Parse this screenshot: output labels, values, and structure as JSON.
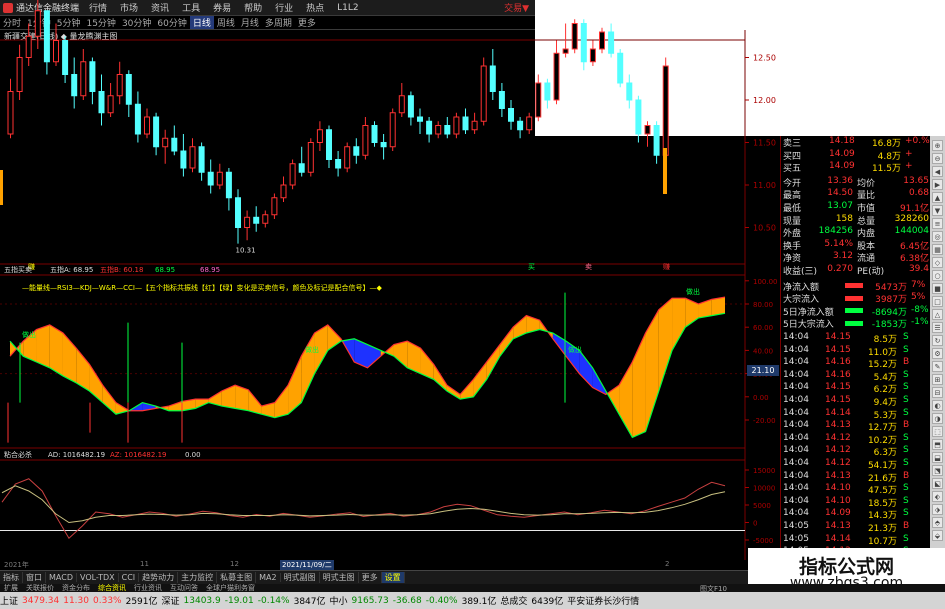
{
  "window": {
    "app_title": "通达信金融终端",
    "brand": "交易▼",
    "menu": [
      "行情",
      "市场",
      "资讯",
      "工具",
      "券易",
      "帮助",
      "行业",
      "热点",
      "L1L2"
    ]
  },
  "periods": {
    "items": [
      "分时",
      "1分钟",
      "5分钟",
      "15分钟",
      "30分钟",
      "60分钟",
      "日线",
      "周线",
      "月线",
      "多周期",
      "更多"
    ],
    "active": 6
  },
  "main_chart": {
    "title": "新疆交建(日线) ◆ 量龙腾渊主图",
    "low_label": "10.31",
    "yticks": [
      "12.50",
      "12.00",
      "11.50",
      "11.00",
      "10.50"
    ],
    "signals": [
      "赚",
      "买",
      "卖",
      "赚"
    ],
    "candles": [
      [
        11.6,
        12.25,
        11.55,
        12.1
      ],
      [
        12.1,
        12.65,
        12.0,
        12.5
      ],
      [
        12.5,
        12.9,
        12.4,
        12.75
      ],
      [
        12.75,
        13.2,
        12.6,
        13.05
      ],
      [
        13.05,
        13.0,
        12.3,
        12.45
      ],
      [
        12.45,
        12.9,
        12.4,
        12.7
      ],
      [
        12.7,
        12.75,
        12.2,
        12.3
      ],
      [
        12.3,
        12.5,
        11.9,
        12.05
      ],
      [
        12.05,
        12.6,
        12.0,
        12.45
      ],
      [
        12.45,
        12.5,
        11.95,
        12.1
      ],
      [
        12.1,
        12.3,
        11.7,
        11.85
      ],
      [
        11.85,
        12.2,
        11.8,
        12.05
      ],
      [
        12.05,
        12.45,
        11.95,
        12.3
      ],
      [
        12.3,
        12.35,
        11.8,
        11.95
      ],
      [
        11.95,
        12.1,
        11.5,
        11.6
      ],
      [
        11.6,
        11.9,
        11.55,
        11.8
      ],
      [
        11.8,
        11.85,
        11.35,
        11.45
      ],
      [
        11.45,
        11.65,
        11.25,
        11.55
      ],
      [
        11.55,
        11.7,
        11.35,
        11.4
      ],
      [
        11.4,
        11.6,
        11.1,
        11.2
      ],
      [
        11.2,
        11.55,
        11.15,
        11.45
      ],
      [
        11.45,
        11.5,
        11.05,
        11.15
      ],
      [
        11.15,
        11.3,
        10.9,
        11.0
      ],
      [
        11.0,
        11.25,
        10.95,
        11.15
      ],
      [
        11.15,
        11.2,
        10.7,
        10.85
      ],
      [
        10.85,
        10.95,
        10.31,
        10.5
      ],
      [
        10.5,
        10.7,
        10.35,
        10.62
      ],
      [
        10.62,
        10.75,
        10.45,
        10.55
      ],
      [
        10.55,
        10.7,
        10.5,
        10.65
      ],
      [
        10.65,
        10.9,
        10.6,
        10.85
      ],
      [
        10.85,
        11.1,
        10.8,
        11.0
      ],
      [
        11.0,
        11.3,
        10.95,
        11.25
      ],
      [
        11.25,
        11.45,
        11.1,
        11.15
      ],
      [
        11.15,
        11.55,
        11.1,
        11.5
      ],
      [
        11.5,
        11.75,
        11.4,
        11.65
      ],
      [
        11.65,
        11.7,
        11.2,
        11.3
      ],
      [
        11.3,
        11.4,
        11.1,
        11.2
      ],
      [
        11.2,
        11.5,
        11.15,
        11.45
      ],
      [
        11.45,
        11.55,
        11.25,
        11.35
      ],
      [
        11.35,
        11.8,
        11.3,
        11.7
      ],
      [
        11.7,
        11.75,
        11.45,
        11.5
      ],
      [
        11.5,
        11.6,
        11.3,
        11.45
      ],
      [
        11.45,
        11.9,
        11.4,
        11.85
      ],
      [
        11.85,
        12.2,
        11.8,
        12.05
      ],
      [
        12.05,
        12.1,
        11.7,
        11.8
      ],
      [
        11.8,
        11.9,
        11.6,
        11.75
      ],
      [
        11.75,
        11.8,
        11.5,
        11.6
      ],
      [
        11.6,
        11.75,
        11.55,
        11.7
      ],
      [
        11.7,
        11.8,
        11.55,
        11.6
      ],
      [
        11.6,
        11.85,
        11.55,
        11.8
      ],
      [
        11.8,
        11.9,
        11.6,
        11.65
      ],
      [
        11.65,
        11.85,
        11.6,
        11.75
      ],
      [
        11.75,
        12.5,
        11.7,
        12.4
      ],
      [
        12.4,
        12.6,
        12.0,
        12.1
      ],
      [
        12.1,
        12.2,
        11.8,
        11.9
      ],
      [
        11.9,
        12.0,
        11.65,
        11.75
      ],
      [
        11.75,
        11.8,
        11.55,
        11.65
      ],
      [
        11.65,
        11.85,
        11.6,
        11.8
      ],
      [
        11.8,
        12.3,
        11.75,
        12.2
      ],
      [
        12.2,
        12.25,
        11.9,
        12.0
      ],
      [
        12.0,
        12.7,
        11.95,
        12.55
      ],
      [
        12.55,
        12.9,
        12.5,
        12.6
      ],
      [
        12.6,
        12.95,
        12.55,
        12.9
      ],
      [
        12.9,
        12.95,
        12.35,
        12.45
      ],
      [
        12.45,
        12.7,
        12.4,
        12.6
      ],
      [
        12.6,
        12.85,
        12.55,
        12.8
      ],
      [
        12.8,
        12.9,
        12.5,
        12.55
      ],
      [
        12.55,
        12.6,
        12.15,
        12.2
      ],
      [
        12.2,
        12.3,
        11.9,
        12.0
      ],
      [
        12.0,
        12.05,
        11.5,
        11.6
      ],
      [
        11.6,
        11.75,
        11.45,
        11.7
      ],
      [
        11.7,
        11.75,
        11.25,
        11.35
      ],
      [
        11.35,
        12.5,
        11.3,
        12.4
      ]
    ]
  },
  "osc": {
    "header": {
      "name": "五指买卖",
      "a": "五指A: 68.95",
      "b": "五指B: 60.18",
      "c": "68.95",
      "d": "68.95"
    },
    "legend": "—能量线—RSI3—KDJ—W&R—CCI—【五个指标共振线【红】【绿】变化是买卖信号，颜色及标记是配合信号】—◆",
    "yticks": [
      "100.00",
      "80.00",
      "60.00",
      "40.00",
      "20.00",
      "0.00",
      "-20.00"
    ],
    "marks": [
      "做出",
      "做出",
      "做出",
      "做出"
    ],
    "upper": [
      35,
      48,
      58,
      62,
      55,
      42,
      28,
      10,
      -5,
      -12,
      -12,
      -10,
      -8,
      -4,
      -2,
      -2,
      5,
      10,
      6,
      -8,
      -5,
      10,
      35,
      55,
      62,
      50,
      30,
      25,
      35,
      45,
      48,
      42,
      28,
      10,
      2,
      15,
      30,
      45,
      60,
      70,
      66,
      50,
      35,
      20,
      8,
      2,
      10,
      30,
      55,
      75,
      85,
      85,
      80,
      84,
      86
    ],
    "lower": [
      48,
      35,
      30,
      25,
      18,
      12,
      5,
      -5,
      -15,
      -12,
      -5,
      -8,
      -12,
      -12,
      -10,
      -5,
      -8,
      -10,
      -12,
      -15,
      -18,
      -15,
      -5,
      20,
      40,
      48,
      50,
      45,
      40,
      35,
      25,
      20,
      15,
      5,
      -2,
      0,
      15,
      35,
      50,
      55,
      58,
      55,
      48,
      40,
      25,
      5,
      -15,
      -35,
      -30,
      5,
      40,
      60,
      68,
      70,
      72
    ]
  },
  "ad": {
    "header": {
      "name": "粘合必杀",
      "ad": "AD: 1016482.19",
      "az": "AZ: 1016482.19",
      "v": "0.00"
    },
    "yticks": [
      "15000",
      "10000",
      "5000",
      "0",
      "-5000"
    ],
    "line1": [
      5800,
      11000,
      12500,
      9000,
      2000,
      -4500,
      -1000,
      3000,
      2500,
      1500,
      2200,
      3000,
      2600,
      1800,
      2400,
      3200,
      2800,
      2000,
      1500,
      2300,
      1800,
      2600,
      2100,
      1500,
      1900,
      2400,
      2800,
      1700,
      2200,
      2600,
      1800,
      2200,
      3000,
      4500,
      5200,
      4800,
      3500,
      2200,
      1800,
      1500,
      2000,
      2500,
      3000,
      2200,
      2800,
      3500,
      3000,
      2500,
      3300,
      4600,
      5800,
      7000,
      9500,
      11500,
      10500
    ],
    "line2": [
      8500,
      10500,
      9000,
      6500,
      2500,
      0,
      500,
      1500,
      2000,
      2000,
      2200,
      2400,
      2300,
      2100,
      2200,
      2600,
      2500,
      2200,
      2000,
      2000,
      2000,
      2200,
      2100,
      1900,
      2000,
      2100,
      2300,
      2100,
      2100,
      2200,
      2100,
      2200,
      2500,
      3200,
      3800,
      4000,
      3800,
      3200,
      2600,
      2200,
      2100,
      2200,
      2500,
      2500,
      2600,
      2800,
      2900,
      2800,
      2900,
      3400,
      4200,
      5200,
      6500,
      8000,
      8800
    ]
  },
  "dates": {
    "start": "2021年",
    "m1": "11",
    "m2": "12",
    "cur": "2021/11/09/二",
    "m3": "2"
  },
  "quote": {
    "levels": [
      {
        "label": "卖三",
        "price": "14.18",
        "vol": "16.8万",
        "tag": "+0.%"
      },
      {
        "label": "买四",
        "price": "14.09",
        "vol": "4.8万",
        "tag": "+"
      },
      {
        "label": "买五",
        "price": "14.09",
        "vol": "11.5万",
        "tag": "+"
      }
    ],
    "stats": [
      {
        "l1": "今开",
        "v1": "13.36",
        "l2": "均价",
        "v2": "13.65"
      },
      {
        "l1": "最高",
        "v1": "14.50",
        "l2": "量比",
        "v2": "0.68"
      },
      {
        "l1": "最低",
        "v1": "13.07",
        "l2": "市值",
        "v2": "91.1亿"
      },
      {
        "l1": "现量",
        "v1": "158",
        "l2": "总量",
        "v2": "328260"
      },
      {
        "l1": "外盘",
        "v1": "184256",
        "l2": "内盘",
        "v2": "144004"
      },
      {
        "l1": "换手",
        "v1": "5.14%",
        "l2": "股本",
        "v2": "6.45亿"
      },
      {
        "l1": "净资",
        "v1": "3.12",
        "l2": "流通",
        "v2": "6.38亿"
      },
      {
        "l1": "收益(三)",
        "v1": "0.270",
        "l2": "PE(动)",
        "v2": "39.4"
      }
    ],
    "flows": [
      {
        "label": "净流入额",
        "value": "5473万",
        "pct": "7%",
        "pos": true
      },
      {
        "label": "大宗流入",
        "value": "3987万",
        "pct": "5%",
        "pos": true
      },
      {
        "label": "5日净流入额",
        "value": "-8694万",
        "pct": "-8%",
        "pos": false
      },
      {
        "label": "5日大宗流入",
        "value": "-1853万",
        "pct": "-1%",
        "pos": false
      }
    ],
    "ticks": [
      [
        "14:04",
        "14.15",
        "8.5万",
        "S"
      ],
      [
        "14:04",
        "14.15",
        "11.0万",
        "S"
      ],
      [
        "14:04",
        "14.16",
        "15.2万",
        "B"
      ],
      [
        "14:04",
        "14.16",
        "5.4万",
        "S"
      ],
      [
        "14:04",
        "14.15",
        "6.2万",
        "S"
      ],
      [
        "14:04",
        "14.15",
        "9.4万",
        "S"
      ],
      [
        "14:04",
        "14.14",
        "5.3万",
        "S"
      ],
      [
        "14:04",
        "14.13",
        "12.7万",
        "B"
      ],
      [
        "14:04",
        "14.12",
        "10.2万",
        "S"
      ],
      [
        "14:04",
        "14.12",
        "6.3万",
        "S"
      ],
      [
        "14:04",
        "14.12",
        "54.1万",
        "S"
      ],
      [
        "14:04",
        "14.13",
        "21.6万",
        "B"
      ],
      [
        "14:04",
        "14.10",
        "47.5万",
        "S"
      ],
      [
        "14:04",
        "14.10",
        "18.5万",
        "S"
      ],
      [
        "14:04",
        "14.09",
        "14.3万",
        "S"
      ],
      [
        "14:05",
        "14.13",
        "21.3万",
        "B"
      ],
      [
        "14:05",
        "14.14",
        "10.7万",
        "S"
      ],
      [
        "14:05",
        "14.13",
        "12.3万",
        "S"
      ],
      [
        "14:05",
        "14.13",
        "11.7万",
        "B"
      ],
      [
        "14:05",
        "14.12",
        "21.3万",
        "S"
      ],
      [
        "14:05",
        "14.13",
        "9.4万",
        "S"
      ]
    ],
    "side_value": "21.10"
  },
  "taskbar": {
    "items": [
      "指标",
      "窗口",
      "MACD",
      "VOL-TDX",
      "CCI",
      "趋势动力",
      "主力监控",
      "私募主图",
      "MA2",
      "明式副图",
      "明式主图",
      "更多",
      "设置"
    ],
    "tabs": [
      "扩展",
      "关联报价",
      "资金分布",
      "综合资讯",
      "行业资讯",
      "互动问答",
      "全球户猫利务窗"
    ],
    "right": "图文F10",
    "right2": "模板"
  },
  "status": {
    "sh_name": "上证",
    "sh_val": "3479.34",
    "sh_chg": "11.30",
    "sh_pct": "0.33%",
    "sh_amt": "2591亿",
    "sz_name": "深证",
    "sz_val": "13403.9",
    "sz_chg": "-19.01",
    "sz_pct": "-0.14%",
    "sz_amt": "3847亿",
    "zx_name": "中小",
    "zx_val": "9165.73",
    "zx_chg": "-36.68",
    "zx_pct": "-0.40%",
    "zx_amt": "389.1亿",
    "total": "总成交",
    "total_val": "6439亿",
    "broker": "平安证券长沙行情"
  },
  "watermark": {
    "line1": "指标公式网",
    "line2": "www.zbgs3.com"
  },
  "colors": {
    "up": "#ff3232",
    "down": "#54ffff",
    "orange": "#ffa200",
    "blue": "#1e32ff",
    "green": "#00ff40",
    "yellow": "#ffff00"
  }
}
